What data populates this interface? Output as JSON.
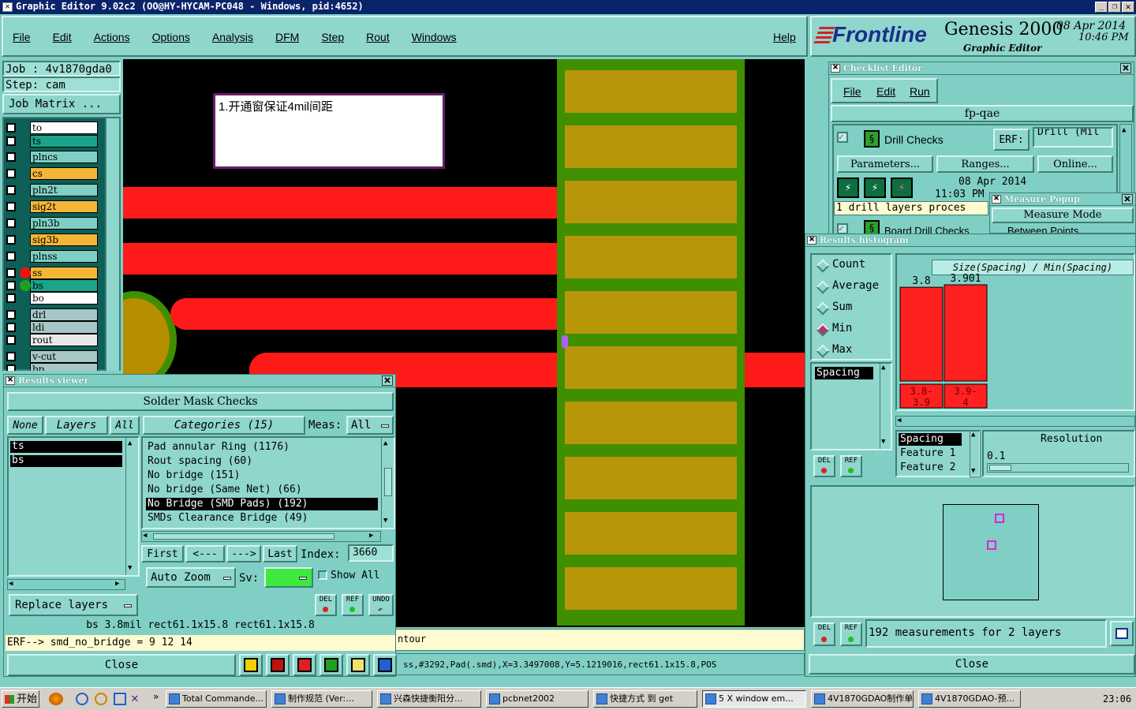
{
  "window": {
    "title": "Graphic Editor 9.02c2 (OO@HY-HYCAM-PC048 - Windows, pid:4652)"
  },
  "menu": [
    "File",
    "Edit",
    "Actions",
    "Options",
    "Analysis",
    "DFM",
    "Step",
    "Rout",
    "Windows"
  ],
  "help": "Help",
  "brand": {
    "logo": "Frontline",
    "product": "Genesis 2000",
    "sub": "Graphic Editor",
    "date": "08 Apr 2014",
    "time": "10:46 PM"
  },
  "job": {
    "job": "Job : 4v1870gda0",
    "step": "Step: cam",
    "matrix": "Job Matrix ..."
  },
  "layers": [
    {
      "name": "to",
      "color": "#ffffff"
    },
    {
      "name": "ts",
      "color": "#1aa58a"
    },
    {
      "name": "plncs",
      "color": "#7fcfc4"
    },
    {
      "name": "cs",
      "color": "#f5b638"
    },
    {
      "name": "pln2t",
      "color": "#7fcfc4"
    },
    {
      "name": "sig2t",
      "color": "#f5b638"
    },
    {
      "name": "pln3b",
      "color": "#7fcfc4"
    },
    {
      "name": "sig3b",
      "color": "#f5b638"
    },
    {
      "name": "plnss",
      "color": "#7fcfc4"
    },
    {
      "name": "ss",
      "color": "#f5b638"
    },
    {
      "name": "bs",
      "color": "#1aa58a"
    },
    {
      "name": "bo",
      "color": "#ffffff"
    },
    {
      "name": "drl",
      "color": "#a7c7c7"
    },
    {
      "name": "ldi",
      "color": "#a7c7c7"
    },
    {
      "name": "rout",
      "color": "#e8e8e8"
    },
    {
      "name": "v-cut",
      "color": "#a7c7c7"
    },
    {
      "name": "bp",
      "color": "#a7c7c7"
    }
  ],
  "note": "1.开通窗保证4mil间距",
  "status_line": "ss,#3292,Pad(.smd),X=3.3497008,Y=5.1219016,rect61.1x15.8,POS",
  "partial_text": "ntour",
  "results_viewer": {
    "title": "Results viewer",
    "header": "Solder Mask Checks",
    "none": "None",
    "layers_label": "Layers",
    "all": "All",
    "layers": [
      "ts",
      "bs"
    ],
    "categories_label": "Categories (15)",
    "meas_label": "Meas:",
    "meas_value": "All",
    "categories": [
      "Pad annular Ring (1176)",
      "Rout spacing (60)",
      "No bridge (151)",
      "No bridge (Same Net) (66)",
      "No Bridge (SMD Pads) (192)",
      "SMDs Clearance Bridge (49)"
    ],
    "first": "First",
    "prev": "<---",
    "next": "--->",
    "last": "Last",
    "index_label": "Index:",
    "index_value": "3660",
    "auto_zoom": "Auto Zoom",
    "sv": "Sv:",
    "show_all": "Show All",
    "replace": "Replace layers",
    "del": "DEL",
    "ref": "REF",
    "undo": "UNDO",
    "info": "bs 3.8mil   rect61.1x15.8   rect61.1x15.8",
    "erf": "ERF--> smd_no_bridge = 9 12 14",
    "close": "Close"
  },
  "checklist": {
    "title": "Checklist Editor",
    "menu": [
      "File",
      "Edit",
      "Run"
    ],
    "name": "fp-qae",
    "item": "Drill Checks",
    "erf": "ERF:",
    "erf_value": "Drill (Mil",
    "params": "Parameters...",
    "ranges": "Ranges...",
    "online": "Online...",
    "date": "08 Apr 2014",
    "time": "11:03 PM",
    "status": "1 drill layers proces",
    "item2": "Board Drill Checks"
  },
  "measure": {
    "title": "Measure Popup",
    "mode": "Measure Mode",
    "item": "Between Points"
  },
  "histogram": {
    "title": "Results histogram",
    "options": [
      "Count",
      "Average",
      "Sum",
      "Min",
      "Max"
    ],
    "selected": "Min",
    "list": [
      "Spacing"
    ],
    "axis_title": "Size(Spacing) / Min(Spacing)",
    "fields": [
      "Spacing",
      "Feature 1",
      "Feature 2"
    ],
    "resolution_label": "Resolution",
    "resolution": "0.1",
    "measurements": "192 measurements for 2 layers",
    "close": "Close",
    "del": "DEL",
    "ref": "REF"
  },
  "chart_data": {
    "type": "bar",
    "categories": [
      "3.8-3.9",
      "3.9-4"
    ],
    "values": [
      3.8,
      3.901
    ],
    "title": "Size(Spacing) / Min(Spacing)",
    "colors": [
      "#ff2020"
    ]
  },
  "taskbar": {
    "start": "开始",
    "items": [
      "Total Commande...",
      "制作规范 (Ver:...",
      "兴森快捷衡阳分...",
      "pcbnet2002",
      "快捷方式 到 get",
      "5 X window em...",
      "4V1870GDAO制作单",
      "4V1870GDAO-预..."
    ],
    "clock": "23:06"
  }
}
